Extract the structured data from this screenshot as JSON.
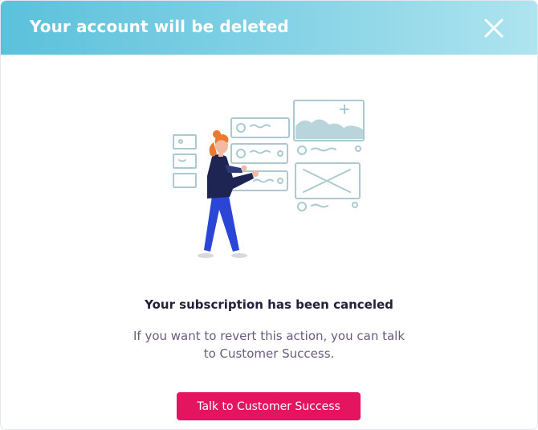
{
  "modal": {
    "title": "Your account will be deleted",
    "close_icon": "close-icon",
    "illustration_icon": "person-presenting-wireframes-illustration",
    "subtitle": "Your subscription has been canceled",
    "message": "If you want to revert this action, you can talk to Customer Success.",
    "cta_label": "Talk to Customer Success"
  },
  "colors": {
    "header_gradient_start": "#5bc1db",
    "header_gradient_end": "#aee4ef",
    "cta_background": "#e5145e",
    "title_text": "#ffffff",
    "subtitle_text": "#24203a",
    "message_text": "#6b5b7e"
  }
}
